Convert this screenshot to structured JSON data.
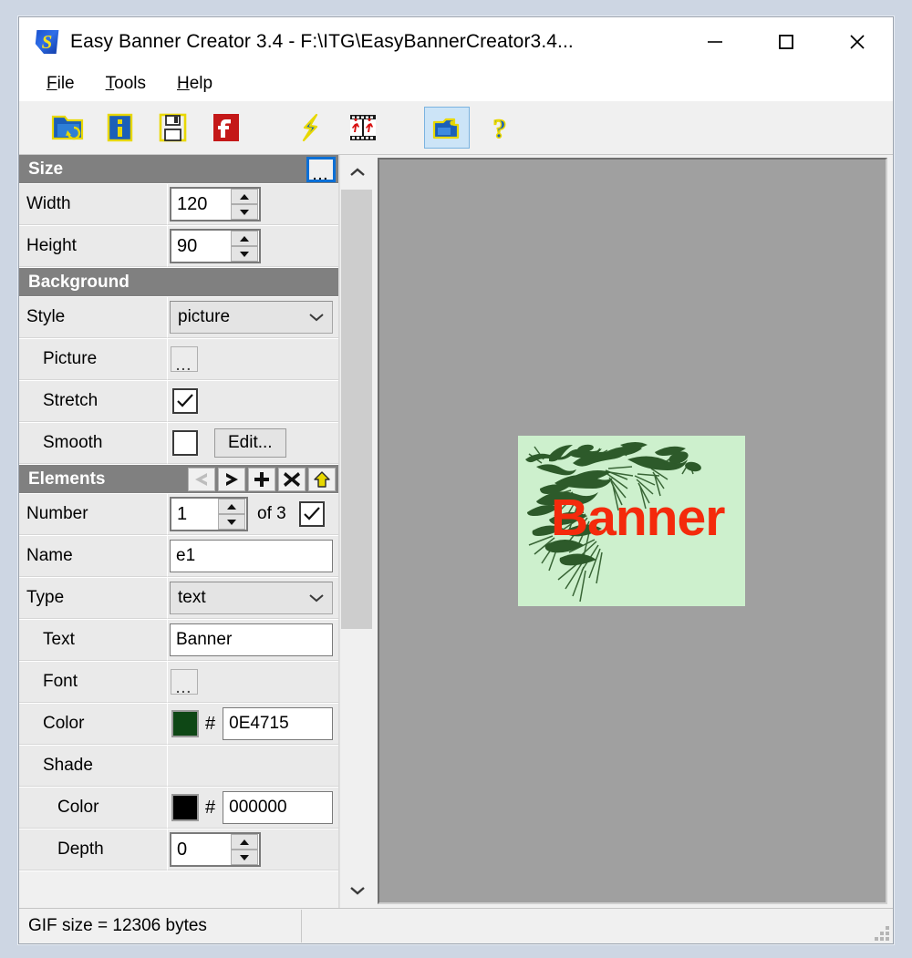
{
  "window": {
    "title": "Easy Banner Creator 3.4 - F:\\ITG\\EasyBannerCreator3.4...",
    "minimize_label": "Minimize",
    "maximize_label": "Maximize",
    "close_label": "Close"
  },
  "menu": {
    "items": [
      {
        "label": "File",
        "mnemonic": "F"
      },
      {
        "label": "Tools",
        "mnemonic": "T"
      },
      {
        "label": "Help",
        "mnemonic": "H"
      }
    ]
  },
  "toolbar": {
    "buttons": [
      {
        "icon": "open-folder-icon",
        "label": "Open"
      },
      {
        "icon": "new-document-icon",
        "label": "New"
      },
      {
        "icon": "save-disk-icon",
        "label": "Save"
      },
      {
        "icon": "flash-export-icon",
        "label": "Export Flash"
      },
      {
        "icon": "lightning-icon",
        "label": "Effects"
      },
      {
        "icon": "film-strip-icon",
        "label": "Animation"
      },
      {
        "icon": "preview-camera-icon",
        "label": "Preview"
      },
      {
        "icon": "help-question-icon",
        "label": "Help"
      }
    ]
  },
  "panel": {
    "size": {
      "header": "Size",
      "options_button": "...",
      "rows": [
        {
          "label": "Width",
          "value": "120"
        },
        {
          "label": "Height",
          "value": "90"
        }
      ]
    },
    "background": {
      "header": "Background",
      "style_label": "Style",
      "style_value": "picture",
      "picture_label": "Picture",
      "picture_button": "...",
      "stretch_label": "Stretch",
      "stretch_checked": true,
      "smooth_label": "Smooth",
      "smooth_checked": false,
      "edit_button": "Edit..."
    },
    "elements": {
      "header": "Elements",
      "buttons": [
        {
          "icon": "previous-element-icon",
          "label": "Previous",
          "enabled": false
        },
        {
          "icon": "next-element-icon",
          "label": "Next",
          "enabled": true
        },
        {
          "icon": "add-element-icon",
          "label": "Add",
          "enabled": true
        },
        {
          "icon": "delete-element-icon",
          "label": "Delete",
          "enabled": true
        },
        {
          "icon": "move-up-icon",
          "label": "Move up",
          "enabled": true
        }
      ],
      "number_label": "Number",
      "number_value": "1",
      "of_count": "of 3",
      "visible_checked": true,
      "name_label": "Name",
      "name_value": "e1",
      "type_label": "Type",
      "type_value": "text",
      "text_label": "Text",
      "text_value": "Banner",
      "font_label": "Font",
      "font_button": "...",
      "color_label": "Color",
      "color_hash": "#",
      "color_value": "0E4715",
      "color_swatch": "#0E4715",
      "shade_label": "Shade",
      "shade_color_label": "Color",
      "shade_color_hash": "#",
      "shade_color_value": "000000",
      "shade_color_swatch": "#000000",
      "depth_label": "Depth",
      "depth_value": "0"
    }
  },
  "canvas": {
    "background_color": "#A0A0A0",
    "banner": {
      "background_color": "#CDF0CD",
      "text": "Banner",
      "text_color": "#F42A0C",
      "artwork": "pine-branch-graphic"
    }
  },
  "statusbar": {
    "gif_size": "GIF size =  12306 bytes",
    "second_cell": ""
  }
}
